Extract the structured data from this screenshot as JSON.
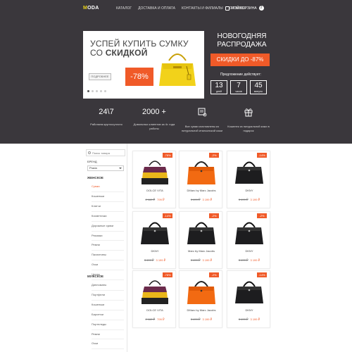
{
  "header": {
    "logo_mark": "M",
    "logo_rest": "ODA",
    "nav": [
      "КАТАЛОГ",
      "ДОСТАВКА И ОПЛАТА",
      "КОНТАКТЫ И ФИЛИАЛЫ",
      "ОТЗЫВЫ"
    ],
    "cart_label": "МОЙ КОРЗИНА",
    "cart_count": "2"
  },
  "banner": {
    "title_line1": "УСПЕЙ КУПИТЬ СУМКУ",
    "title_line2_prefix": "СО",
    "title_line2_bold": "СКИДКОЙ",
    "more_button": "ПОДРОБНЕЕ",
    "discount": "-78%",
    "slide_count": 5,
    "active_slide": 1
  },
  "promo": {
    "title_line1": "НОВОГОДНЯЯ",
    "title_line2": "РАСПРОДАЖА",
    "badge": "СКИДКИ ДО -87%",
    "valid_label": "Предложение действует:",
    "timer": [
      {
        "value": "13",
        "unit": "дней"
      },
      {
        "value": "7",
        "unit": "часов"
      },
      {
        "value": "45",
        "unit": "минуты"
      }
    ]
  },
  "features": [
    {
      "big": "24\\7",
      "text": "Работаем круглосуточно"
    },
    {
      "big": "2000 +",
      "text": "Довольных клиентов за 4г. года работы"
    },
    {
      "icon": "certificate-icon",
      "text": "Все сумки изготовлены из натуральной итальянской кожи"
    },
    {
      "icon": "gift-icon",
      "text": "Кошелек из натуральной кожи в подарок"
    }
  ],
  "sidebar": {
    "search_placeholder": "Поиск товара",
    "brand_label": "БРЕНД",
    "brand_value": "Prada",
    "women_heading": "ЖЕНСКОЕ",
    "women_items": [
      "Сумки",
      "Кошельки",
      "Клатчи",
      "Косметички",
      "Дорожные сумки",
      "Рюкзаки",
      "Ремни",
      "Палантины",
      "Очки",
      "Чехлы"
    ],
    "women_active": "Сумки",
    "men_heading": "МУЖСКОЕ",
    "men_items": [
      "Дипломаты",
      "Портфели",
      "Кошельки",
      "Барсетки",
      "Портпледы",
      "Ремни",
      "Очки"
    ]
  },
  "products": [
    {
      "name": "DOLCE VITA",
      "badge": "-78%",
      "old": "2 160 ₽",
      "new": "799 ₽",
      "bag": "yellow"
    },
    {
      "name": "DMarc by Marc Jacobs",
      "badge": "-2%",
      "old": "3 499 ₽",
      "new": "3 199 ₽",
      "bag": "orange"
    },
    {
      "name": "DKNY",
      "badge": "-14%",
      "old": "3 499 ₽",
      "new": "3 199 ₽",
      "bag": "black"
    },
    {
      "name": "DKNY",
      "badge": "-14%",
      "old": "3 499 ₽",
      "new": "3 199 ₽",
      "bag": "black"
    },
    {
      "name": "Marc by Marc Jacobs",
      "badge": "-2%",
      "old": "3 499 ₽",
      "new": "3 199 ₽",
      "bag": "black"
    },
    {
      "name": "DKNY",
      "badge": "-2%",
      "old": "3 499 ₽",
      "new": "3 199 ₽",
      "bag": "black"
    },
    {
      "name": "DOLCE VITA",
      "badge": "-78%",
      "old": "2 160 ₽",
      "new": "799 ₽",
      "bag": "yellow"
    },
    {
      "name": "DMarc by Marc Jacobs",
      "badge": "-2%",
      "old": "3 499 ₽",
      "new": "3 199 ₽",
      "bag": "orange"
    },
    {
      "name": "DKNY",
      "badge": "-14%",
      "old": "3 499 ₽",
      "new": "3 199 ₽",
      "bag": "black"
    }
  ],
  "colors": {
    "dark_bg": "#3a373c",
    "accent": "#f05a28",
    "logo": "#e8d21a"
  }
}
